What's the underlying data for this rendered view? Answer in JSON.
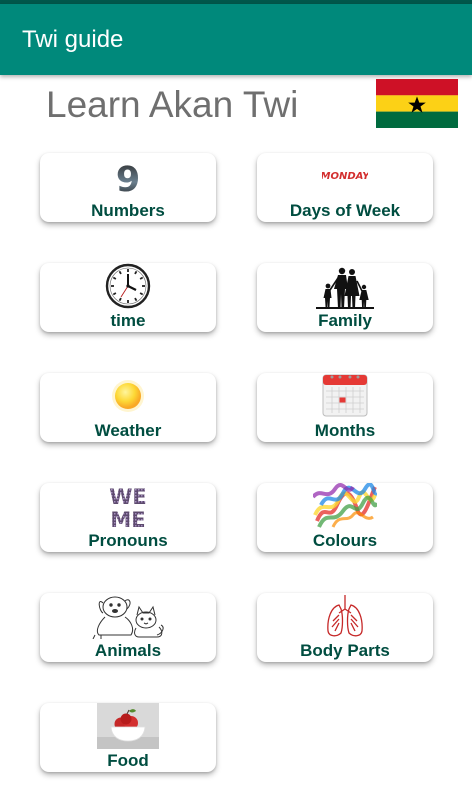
{
  "app_bar": {
    "title": "Twi guide"
  },
  "header": {
    "title": "Learn Akan Twi",
    "flag_icon": "ghana-flag-icon"
  },
  "colors": {
    "app_bar": "#00897b",
    "status_bar": "#00574b",
    "card_label": "#004d40",
    "heading": "#6f6f6f"
  },
  "categories": [
    {
      "label": "Numbers",
      "icon": "number-nine-icon",
      "icon_text": "9"
    },
    {
      "label": "Days of Week",
      "icon": "monday-text-icon",
      "icon_text": "MONDAY"
    },
    {
      "label": "time",
      "icon": "clock-icon"
    },
    {
      "label": "Family",
      "icon": "family-silhouette-icon"
    },
    {
      "label": "Weather",
      "icon": "sun-icon"
    },
    {
      "label": "Months",
      "icon": "calendar-icon"
    },
    {
      "label": "Pronouns",
      "icon": "we-me-icon",
      "icon_text": [
        "WE",
        "ME"
      ]
    },
    {
      "label": "Colours",
      "icon": "rainbow-smoke-icon"
    },
    {
      "label": "Animals",
      "icon": "puppy-kitten-icon"
    },
    {
      "label": "Body Parts",
      "icon": "lungs-icon"
    },
    {
      "label": "Food",
      "icon": "apple-bowl-icon"
    }
  ]
}
